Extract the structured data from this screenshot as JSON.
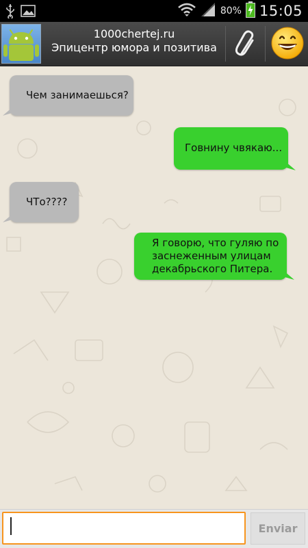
{
  "status_bar": {
    "battery_percent": "80%",
    "time": "15:05",
    "icons": [
      "usb-icon",
      "gallery-icon",
      "wifi-icon",
      "signal-icon",
      "battery-charging-icon"
    ]
  },
  "header": {
    "contact_name": "1000chertej.ru",
    "contact_status": "Эпицентр юмора и позитива",
    "avatar_icon": "android-robot-icon",
    "attach_icon": "paperclip-icon",
    "emoji_icon": "smiley-icon"
  },
  "messages": [
    {
      "direction": "in",
      "text": "Чем занимаешься?"
    },
    {
      "direction": "out",
      "text": "Говнину чвякаю..."
    },
    {
      "direction": "in",
      "text": "ЧТо????"
    },
    {
      "direction": "out",
      "lines": [
        "Я говорю, что гуляю по",
        "заснеженным улицам",
        "декабрьского Питера."
      ]
    }
  ],
  "composer": {
    "input_value": "",
    "send_label": "Enviar"
  },
  "colors": {
    "incoming_bubble": "#b9b9b9",
    "outgoing_bubble": "#39d02e",
    "input_focus_border": "#f7941d",
    "chat_background": "#ece6da"
  }
}
